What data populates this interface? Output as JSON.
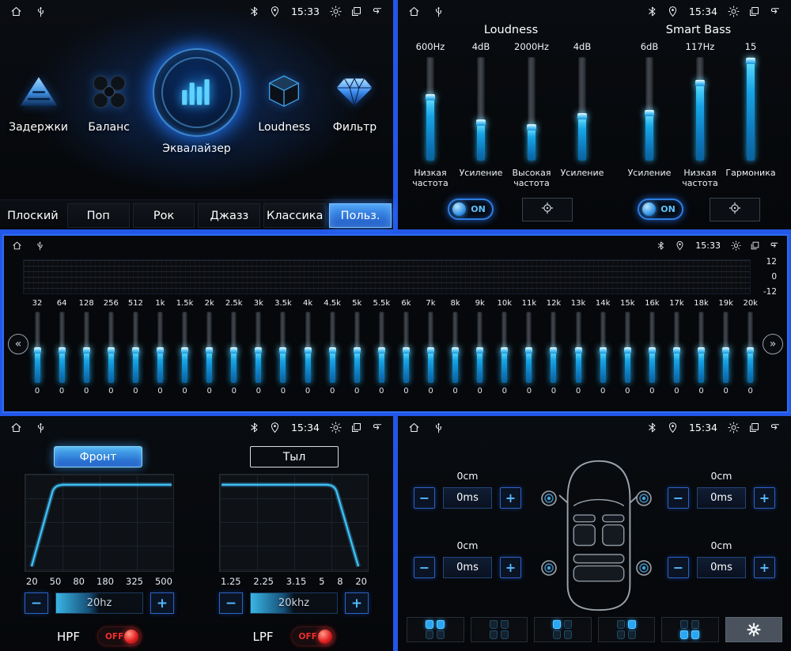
{
  "controls": {
    "minus": "−",
    "plus": "+",
    "prev": "«",
    "next": "»"
  },
  "status_bar": {
    "left": [
      "home",
      "usb"
    ],
    "right": [
      "bluetooth",
      "location",
      "time",
      "brightness",
      "windows",
      "back"
    ]
  },
  "menu": {
    "time": "15:33",
    "items": [
      {
        "label": "Задержки",
        "icon": "delays-pyramid-icon"
      },
      {
        "label": "Баланс",
        "icon": "balance-icon"
      },
      {
        "label": "Эквалайзер",
        "icon": "equalizer-icon"
      },
      {
        "label": "Loudness",
        "icon": "loudness-cube-icon"
      },
      {
        "label": "Фильтр",
        "icon": "filter-diamond-icon"
      }
    ],
    "presets": [
      {
        "label": "Плоский",
        "active": false
      },
      {
        "label": "Поп",
        "active": false
      },
      {
        "label": "Рок",
        "active": false
      },
      {
        "label": "Джазз",
        "active": false
      },
      {
        "label": "Классика",
        "active": false
      },
      {
        "label": "Польз.",
        "active": true
      }
    ]
  },
  "loudness": {
    "time": "15:34",
    "section_titles": [
      "Loudness",
      "Smart Bass"
    ],
    "sliders": [
      {
        "value": "600Hz",
        "label": "Низкая частота",
        "fill": 61
      },
      {
        "value": "4dB",
        "label": "Усиление",
        "fill": 37
      },
      {
        "value": "2000Hz",
        "label": "Высокая частота",
        "fill": 32
      },
      {
        "value": "4dB",
        "label": "Усиление",
        "fill": 43
      },
      {
        "value": "6dB",
        "label": "Усиление",
        "fill": 46
      },
      {
        "value": "117Hz",
        "label": "Низкая частота",
        "fill": 75
      },
      {
        "value": "15",
        "label": "Гармоника",
        "fill": 96
      }
    ],
    "toggles": [
      {
        "label": "ON",
        "state": true
      },
      {
        "label": "ON",
        "state": true
      }
    ]
  },
  "equalizer": {
    "time": "15:33",
    "scale": [
      "12",
      "0",
      "-12"
    ],
    "band_freqs": [
      "32",
      "64",
      "128",
      "256",
      "512",
      "1k",
      "1.5k",
      "2k",
      "2.5k",
      "3k",
      "3.5k",
      "4k",
      "4.5k",
      "5k",
      "5.5k",
      "6k",
      "7k",
      "8k",
      "9k",
      "10k",
      "11k",
      "12k",
      "13k",
      "14k",
      "15k",
      "16k",
      "17k",
      "18k",
      "19k",
      "20k"
    ],
    "band_value": "0",
    "band_fill": 46
  },
  "filters": {
    "time": "15:34",
    "tabs": [
      {
        "label": "Фронт",
        "active": true
      },
      {
        "label": "Тыл",
        "active": false
      }
    ],
    "hpf": {
      "name": "HPF",
      "value": "20hz",
      "axis": [
        "20",
        "50",
        "80",
        "180",
        "325",
        "500"
      ],
      "toggle": "OFF"
    },
    "lpf": {
      "name": "LPF",
      "value": "20khz",
      "axis": [
        "1.25",
        "2.25",
        "3.15",
        "5",
        "8",
        "20"
      ],
      "toggle": "OFF"
    }
  },
  "delays": {
    "time": "15:34",
    "corners": [
      {
        "position": "front-left",
        "distance": "0cm",
        "delay": "0ms"
      },
      {
        "position": "front-right",
        "distance": "0cm",
        "delay": "0ms"
      },
      {
        "position": "rear-left",
        "distance": "0cm",
        "delay": "0ms"
      },
      {
        "position": "rear-right",
        "distance": "0cm",
        "delay": "0ms"
      }
    ],
    "buttons": [
      {
        "type": "seats",
        "pattern": [
          1,
          1,
          0,
          0
        ]
      },
      {
        "type": "seats",
        "pattern": [
          0,
          0,
          0,
          0
        ]
      },
      {
        "type": "seats",
        "pattern": [
          1,
          0,
          0,
          0
        ]
      },
      {
        "type": "seats",
        "pattern": [
          0,
          1,
          0,
          0
        ]
      },
      {
        "type": "seats",
        "pattern": [
          0,
          0,
          1,
          1
        ]
      },
      {
        "type": "gear"
      }
    ]
  }
}
